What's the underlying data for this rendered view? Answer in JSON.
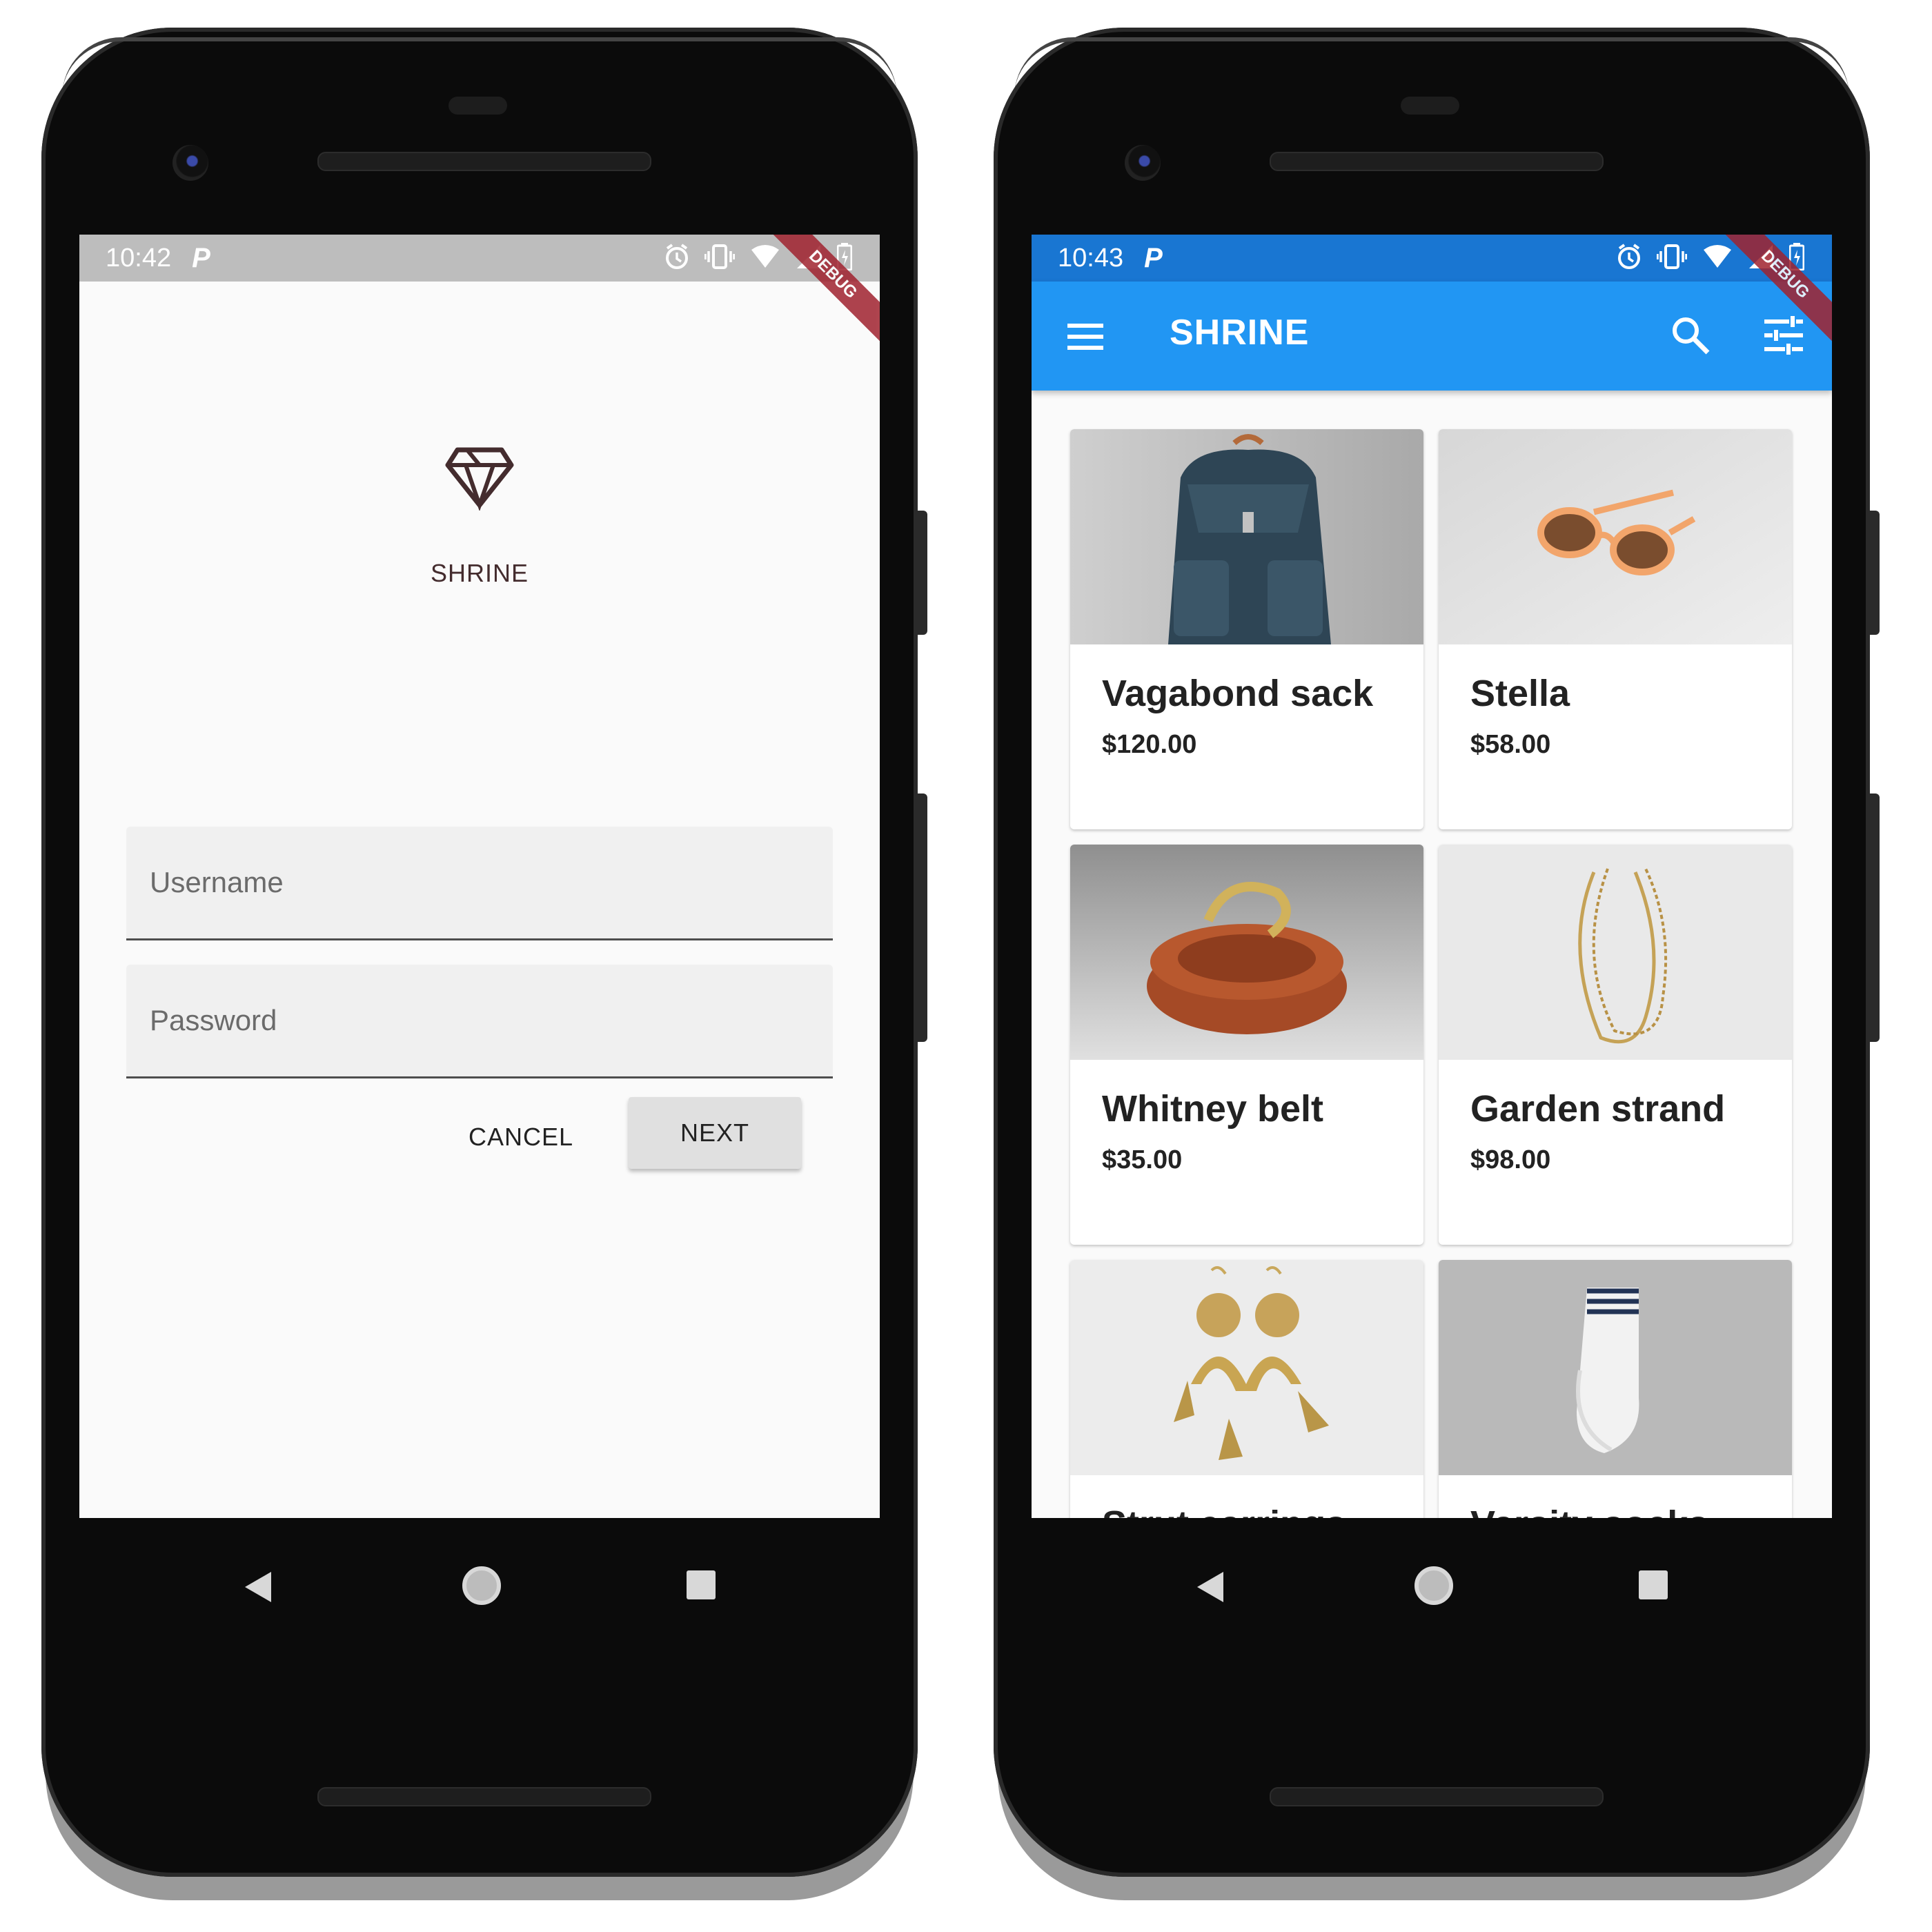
{
  "login_phone": {
    "status": {
      "time": "10:42",
      "notif_glyph": "P",
      "icons": [
        "alarm-icon",
        "vibrate-icon",
        "wifi-icon",
        "signal-icon",
        "battery-icon"
      ]
    },
    "debug_banner": "DEBUG",
    "logo_text": "SHRINE",
    "username_placeholder": "Username",
    "password_placeholder": "Password",
    "cancel_label": "CANCEL",
    "next_label": "NEXT"
  },
  "shop_phone": {
    "status": {
      "time": "10:43",
      "notif_glyph": "P",
      "icons": [
        "alarm-icon",
        "vibrate-icon",
        "wifi-icon",
        "signal-icon",
        "battery-icon"
      ]
    },
    "debug_banner": "DEBUG",
    "appbar": {
      "title": "SHRINE",
      "menu_icon": "menu-icon",
      "search_icon": "search-icon",
      "filter_icon": "tune-icon"
    },
    "products": [
      {
        "name": "Vagabond sack",
        "price": "$120.00"
      },
      {
        "name": "Stella",
        "price": "$58.00"
      },
      {
        "name": "Whitney belt",
        "price": "$35.00"
      },
      {
        "name": "Garden strand",
        "price": "$98.00"
      },
      {
        "name": "Strut earrings",
        "price": ""
      },
      {
        "name": "Varsity socks",
        "price": ""
      }
    ]
  },
  "colors": {
    "primary": "#2196f3",
    "status_login": "#bdbdbd",
    "status_shop": "#1976d2",
    "brand_text": "#442c2e",
    "debug": "#a0232f"
  }
}
